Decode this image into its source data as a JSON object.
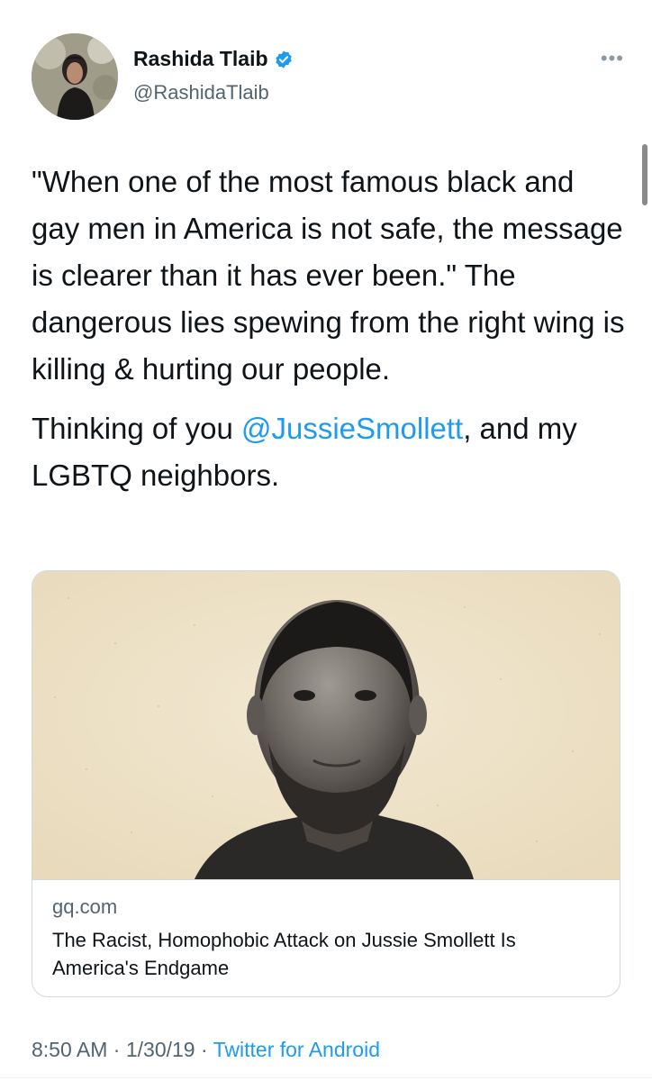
{
  "author": {
    "display_name": "Rashida Tlaib",
    "handle": "@RashidaTlaib",
    "verified": true,
    "avatar_icon": "avatar-photo"
  },
  "tweet": {
    "paragraph1": "\"When one of the most famous black and gay men in America is not safe, the message is clearer than it has ever been.\" The dangerous lies spewing from the right wing is killing & hurting our people.",
    "paragraph2_before": "Thinking of you ",
    "mention": "@JussieSmollett",
    "paragraph2_after": ", and my LGBTQ neighbors."
  },
  "link_card": {
    "domain": "gq.com",
    "title": "The Racist, Homophobic Attack on Jussie Smollett Is America's Endgame",
    "image_icon": "portrait-photo"
  },
  "meta": {
    "time": "8:50 AM",
    "separator": " · ",
    "date": "1/30/19",
    "source": "Twitter for Android"
  },
  "colors": {
    "link_blue": "#1d9bf0",
    "secondary_text": "#536471",
    "primary_text": "#0f1419",
    "card_background": "#efe3c9"
  }
}
